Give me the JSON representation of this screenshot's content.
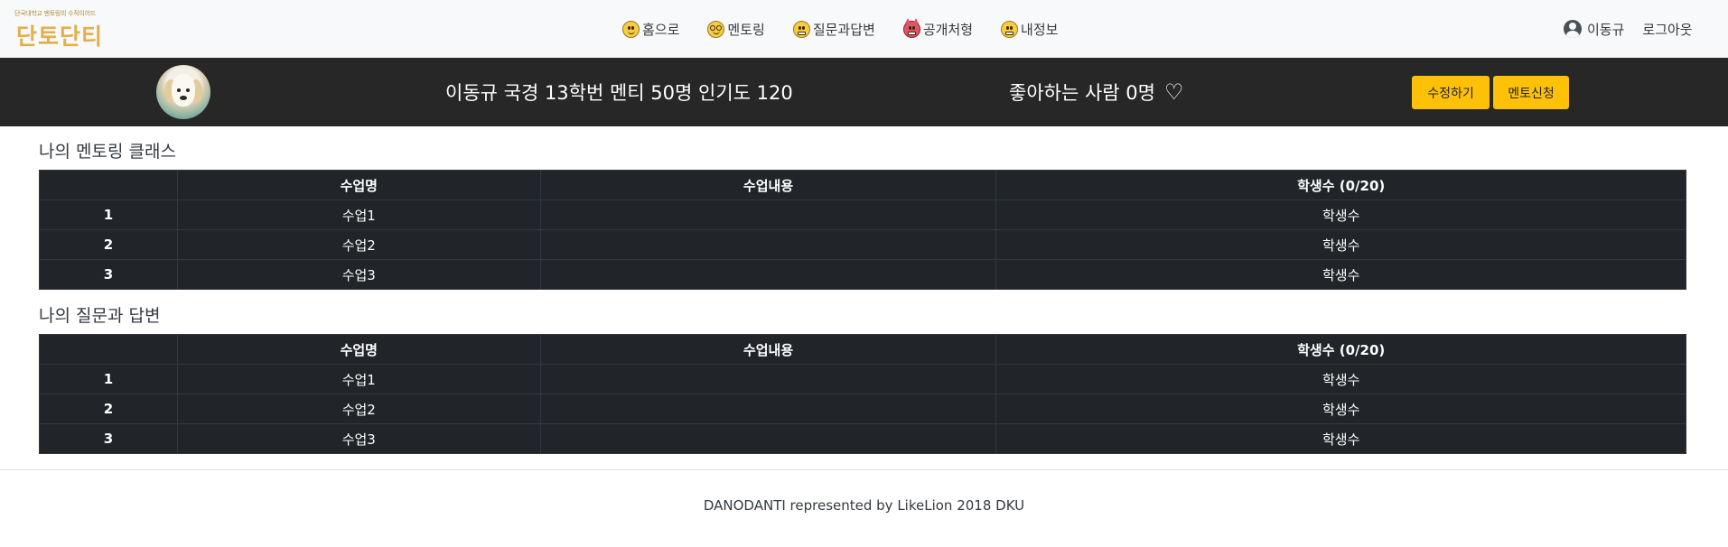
{
  "brand": {
    "tagline": "단국대학교 멘토링의 수직이어드",
    "logo_text": "단토단티"
  },
  "nav": {
    "items": [
      {
        "label": "홈으로",
        "icon": "smile-emoji-icon"
      },
      {
        "label": "멘토링",
        "icon": "nerd-glasses-emoji-icon"
      },
      {
        "label": "질문과답변",
        "icon": "grimace-emoji-icon"
      },
      {
        "label": "공개처형",
        "icon": "devil-emoji-icon"
      },
      {
        "label": "내정보",
        "icon": "grimace-emoji-icon"
      }
    ],
    "user_name": "이동규",
    "logout": "로그아웃"
  },
  "profile": {
    "info": "이동규 국경 13학번 멘티 50명 인기도 120",
    "likes": "좋아하는 사람 0명",
    "heart": "♡",
    "edit_button": "수정하기",
    "apply_button": "멘토신청"
  },
  "sections": [
    {
      "title": "나의 멘토링 클래스",
      "columns": [
        "",
        "수업명",
        "수업내용",
        "학생수 (0/20)"
      ],
      "rows": [
        [
          "1",
          "수업1",
          "",
          "학생수"
        ],
        [
          "2",
          "수업2",
          "",
          "학생수"
        ],
        [
          "3",
          "수업3",
          "",
          "학생수"
        ]
      ]
    },
    {
      "title": "나의 질문과 답변",
      "columns": [
        "",
        "수업명",
        "수업내용",
        "학생수 (0/20)"
      ],
      "rows": [
        [
          "1",
          "수업1",
          "",
          "학생수"
        ],
        [
          "2",
          "수업2",
          "",
          "학생수"
        ],
        [
          "3",
          "수업3",
          "",
          "학생수"
        ]
      ]
    }
  ],
  "footer": "DANODANTI represented by LikeLion 2018 DKU",
  "colors": {
    "accent": "#ffc107",
    "dark_bar": "#272727",
    "table_bg": "#212529",
    "navbar_bg": "#f8f9fa"
  }
}
